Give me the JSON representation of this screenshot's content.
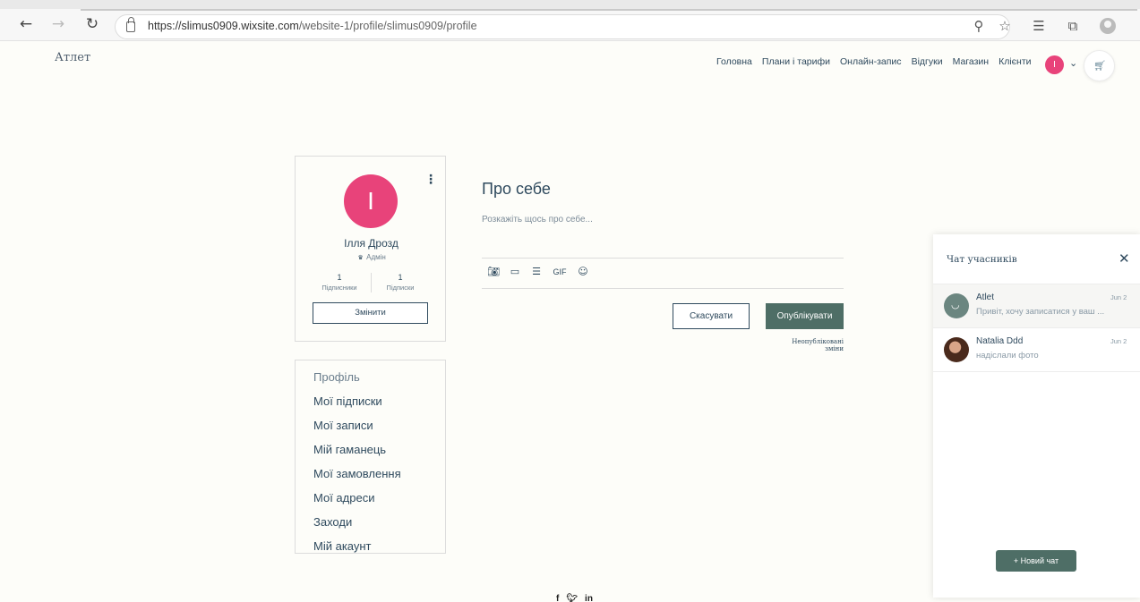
{
  "browser": {
    "url_host": "https://slimus0909.wixsite.com",
    "url_path": "/website-1/profile/slimus0909/profile"
  },
  "site": {
    "logo": "Атлет",
    "nav": [
      "Головна",
      "Плани і тарифи",
      "Онлайн-запис",
      "Відгуки",
      "Магазин",
      "Клієнти"
    ],
    "user_initial": "I"
  },
  "profile": {
    "initial": "I",
    "name": "Ілля Дрозд",
    "role": "Адмін",
    "followers_count": "1",
    "followers_label": "Підписники",
    "following_count": "1",
    "following_label": "Підписки",
    "edit_label": "Змінити"
  },
  "menu": {
    "items": [
      "Профіль",
      "Мої підписки",
      "Мої записи",
      "Мій гаманець",
      "Мої замовлення",
      "Мої адреси",
      "Заходи",
      "Мій акаунт"
    ]
  },
  "about": {
    "title": "Про себе",
    "placeholder": "Розкажіть щось про себе...",
    "gif_label": "GIF",
    "cancel_label": "Скасувати",
    "publish_label": "Опублікувати",
    "unpublished_note": "Неопубліковані зміни"
  },
  "chat": {
    "title": "Чат учасників",
    "conversations": [
      {
        "name": "Atlet",
        "date": "Jun 2",
        "preview": "Привіт, хочу записатися у ваш ..."
      },
      {
        "name": "Natalia Ddd",
        "date": "Jun 2",
        "preview": "надіслали фото"
      }
    ],
    "new_chat_label": "+ Новий чат"
  }
}
